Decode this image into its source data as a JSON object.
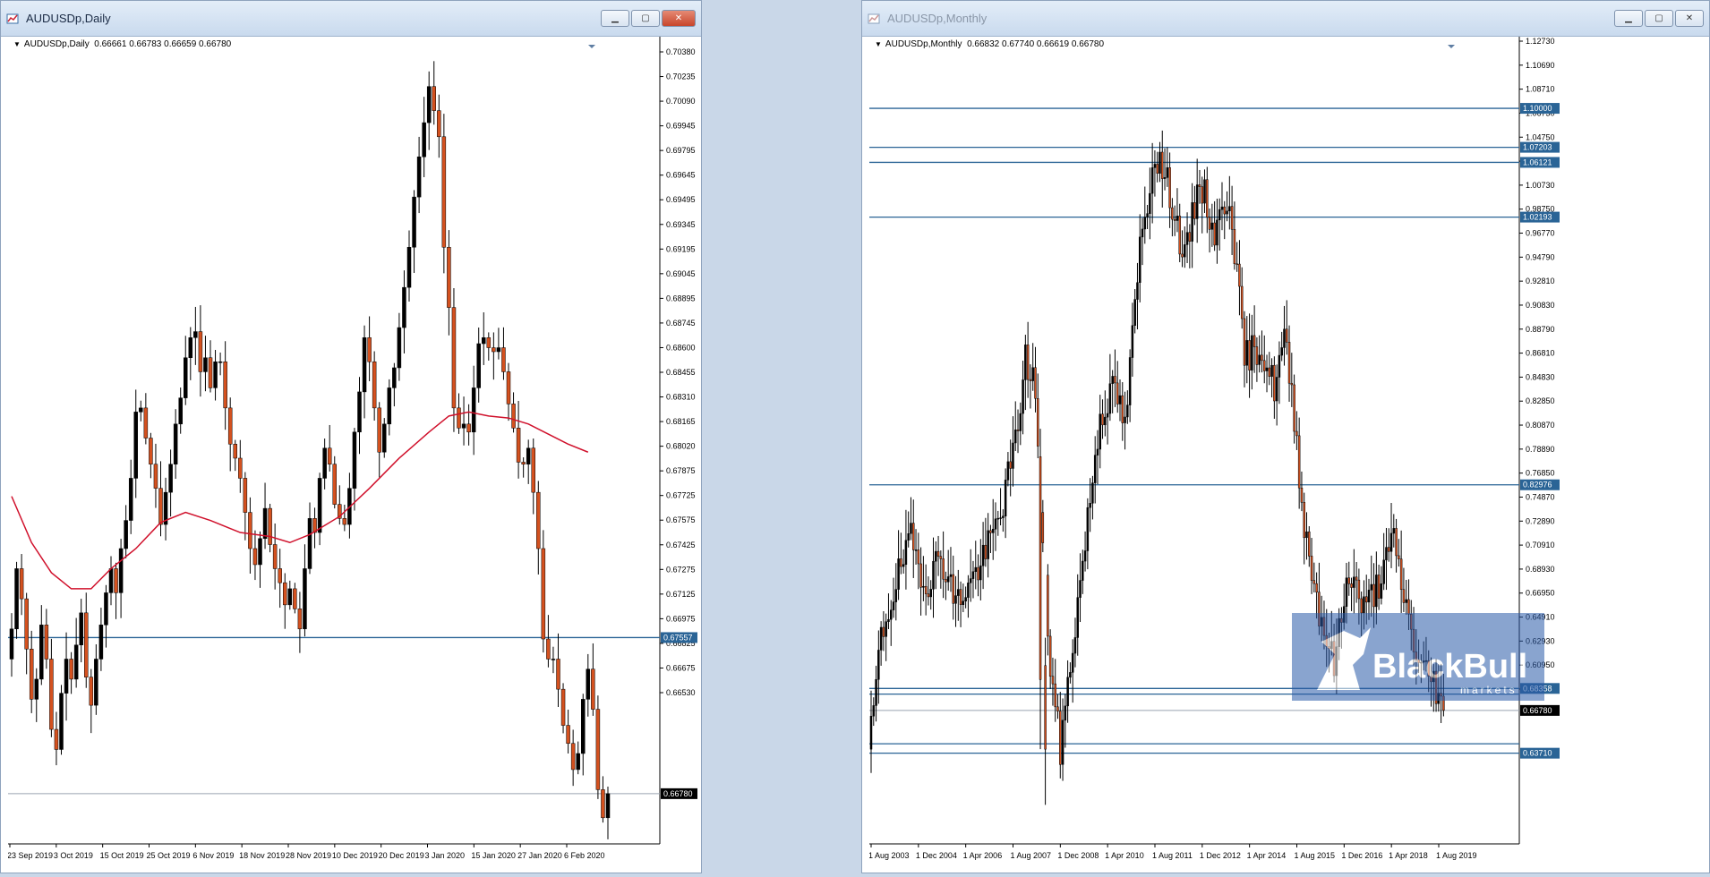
{
  "windows": {
    "left": {
      "title": "AUDUSDp,Daily",
      "info_symbol": "AUDUSDp,Daily",
      "info_ohlc": "0.66661 0.66783 0.66659 0.66780",
      "price_scale": [
        "0.70380",
        "0.70235",
        "0.70090",
        "0.69945",
        "0.69795",
        "0.69645",
        "0.69495",
        "0.69345",
        "0.69195",
        "0.69045",
        "0.68895",
        "0.68745",
        "0.68600",
        "0.68455",
        "0.68310",
        "0.68165",
        "0.68020",
        "0.67875",
        "0.67725",
        "0.67575",
        "0.67425",
        "0.67275",
        "0.67125",
        "0.66975",
        "0.66825",
        "0.66675",
        "0.66530"
      ],
      "date_scale": [
        "23 Sep 2019",
        "3 Oct 2019",
        "15 Oct 2019",
        "25 Oct 2019",
        "6 Nov 2019",
        "18 Nov 2019",
        "28 Nov 2019",
        "10 Dec 2019",
        "20 Dec 2019",
        "3 Jan 2020",
        "15 Jan 2020",
        "27 Jan 2020",
        "6 Feb 2020"
      ],
      "line_tags": [
        "0.67557"
      ],
      "current_tag": "0.66780",
      "line_levels": [
        0.67557
      ],
      "current_price": 0.6678
    },
    "right": {
      "title": "AUDUSDp,Monthly",
      "info_symbol": "AUDUSDp,Monthly",
      "info_ohlc": "0.66832 0.67740 0.66619 0.66780",
      "price_scale": [
        "1.12730",
        "1.10690",
        "1.08710",
        "1.06730",
        "1.04750",
        "1.02770",
        "1.00730",
        "0.98750",
        "0.96770",
        "0.94790",
        "0.92810",
        "0.90830",
        "0.88790",
        "0.86810",
        "0.84830",
        "0.82850",
        "0.80870",
        "0.78890",
        "0.76850",
        "0.74870",
        "0.72890",
        "0.70910",
        "0.68930",
        "0.66950",
        "0.64910",
        "0.62930",
        "0.60950",
        "0.58970"
      ],
      "date_scale": [
        "1 Aug 2003",
        "1 Dec 2004",
        "1 Apr 2006",
        "1 Aug 2007",
        "1 Dec 2008",
        "1 Apr 2010",
        "1 Aug 2011",
        "1 Dec 2012",
        "1 Apr 2014",
        "1 Aug 2015",
        "1 Dec 2016",
        "1 Apr 2018",
        "1 Aug 2019"
      ],
      "line_tags": [
        "1.10000",
        "1.07203",
        "1.06121",
        "1.02193",
        "0.82976",
        "0.68358",
        "0.63710"
      ],
      "current_tag": "0.66780",
      "line_levels": [
        1.1,
        1.07203,
        1.06121,
        1.02193,
        0.82976,
        0.68358,
        0.6795,
        0.64387,
        0.6371
      ],
      "current_price": 0.6678
    }
  },
  "colors": {
    "bull": "#000000",
    "bear": "#d4511f",
    "ma": "#d0102b",
    "hline": "#2a6496",
    "tag_bg": "#2a6496",
    "current_bg": "#000000",
    "close_btn": "#c8462c"
  },
  "watermark": {
    "brand": "BlackBull",
    "sub": "markets"
  },
  "chart_data": [
    {
      "type": "candlestick",
      "title": "AUDUSDp,Daily",
      "ylim": [
        0.6653,
        0.7045
      ],
      "x_ticks": [
        "23 Sep 2019",
        "3 Oct 2019",
        "15 Oct 2019",
        "25 Oct 2019",
        "6 Nov 2019",
        "18 Nov 2019",
        "28 Nov 2019",
        "10 Dec 2019",
        "20 Dec 2019",
        "3 Jan 2020",
        "15 Jan 2020",
        "27 Jan 2020",
        "6 Feb 2020"
      ],
      "ma_period_shown": true,
      "closes": [
        0.676,
        0.679,
        0.6775,
        0.675,
        0.6725,
        0.6735,
        0.6762,
        0.6745,
        0.671,
        0.67,
        0.6728,
        0.6745,
        0.6735,
        0.6752,
        0.6768,
        0.6736,
        0.6722,
        0.6745,
        0.6762,
        0.6778,
        0.679,
        0.6778,
        0.68,
        0.6814,
        0.6835,
        0.6868,
        0.687,
        0.6855,
        0.6842,
        0.683,
        0.6812,
        0.6828,
        0.6842,
        0.6862,
        0.6875,
        0.6895,
        0.6905,
        0.6908,
        0.6888,
        0.6895,
        0.688,
        0.6893,
        0.6893,
        0.687,
        0.6852,
        0.6845,
        0.6835,
        0.6818,
        0.68,
        0.6792,
        0.6805,
        0.682,
        0.6802,
        0.679,
        0.6783,
        0.6772,
        0.678,
        0.677,
        0.676,
        0.679,
        0.6815,
        0.6808,
        0.6835,
        0.685,
        0.6842,
        0.6822,
        0.6815,
        0.6812,
        0.683,
        0.6858,
        0.6878,
        0.6905,
        0.6893,
        0.687,
        0.6848,
        0.6862,
        0.688,
        0.689,
        0.691,
        0.693,
        0.695,
        0.6975,
        0.6995,
        0.7012,
        0.703,
        0.7018,
        0.7005,
        0.695,
        0.692,
        0.687,
        0.686,
        0.6862,
        0.6858,
        0.688,
        0.6902,
        0.6905,
        0.69,
        0.6898,
        0.69,
        0.6888,
        0.6872,
        0.686,
        0.6843,
        0.6842,
        0.685,
        0.6828,
        0.68,
        0.6755,
        0.6745,
        0.6745,
        0.673,
        0.6712,
        0.6703,
        0.669,
        0.6698,
        0.6725,
        0.674,
        0.672,
        0.668,
        0.6666,
        0.6678
      ],
      "ma_range_approx": [
        0.6768,
        0.6868
      ],
      "hlines": [
        0.67557
      ],
      "current": 0.6678
    },
    {
      "type": "candlestick",
      "title": "AUDUSDp,Monthly",
      "ylim": [
        0.572,
        1.1373
      ],
      "x_ticks": [
        "1 Aug 2003",
        "1 Dec 2004",
        "1 Apr 2006",
        "1 Aug 2007",
        "1 Dec 2008",
        "1 Apr 2010",
        "1 Aug 2011",
        "1 Dec 2012",
        "1 Apr 2014",
        "1 Aug 2015",
        "1 Dec 2016",
        "1 Apr 2018",
        "1 Aug 2019"
      ],
      "anchors": [
        [
          0,
          0.652
        ],
        [
          4,
          0.72
        ],
        [
          10,
          0.76
        ],
        [
          16,
          0.79
        ],
        [
          22,
          0.758
        ],
        [
          28,
          0.78
        ],
        [
          34,
          0.745
        ],
        [
          40,
          0.76
        ],
        [
          46,
          0.78
        ],
        [
          52,
          0.81
        ],
        [
          58,
          0.86
        ],
        [
          62,
          0.92
        ],
        [
          66,
          0.9
        ],
        [
          68,
          0.81
        ],
        [
          72,
          0.7
        ],
        [
          76,
          0.64
        ],
        [
          80,
          0.7
        ],
        [
          86,
          0.79
        ],
        [
          92,
          0.88
        ],
        [
          98,
          0.9
        ],
        [
          102,
          0.87
        ],
        [
          108,
          1.0
        ],
        [
          114,
          1.07
        ],
        [
          120,
          1.04
        ],
        [
          126,
          0.99
        ],
        [
          132,
          1.05
        ],
        [
          138,
          1.01
        ],
        [
          144,
          1.04
        ],
        [
          150,
          0.92
        ],
        [
          156,
          0.93
        ],
        [
          162,
          0.9
        ],
        [
          166,
          0.935
        ],
        [
          170,
          0.88
        ],
        [
          174,
          0.8
        ],
        [
          180,
          0.74
        ],
        [
          186,
          0.7
        ],
        [
          192,
          0.77
        ],
        [
          198,
          0.74
        ],
        [
          204,
          0.76
        ],
        [
          210,
          0.79
        ],
        [
          214,
          0.75
        ],
        [
          220,
          0.7
        ],
        [
          226,
          0.69
        ],
        [
          230,
          0.6678
        ]
      ],
      "hlines": [
        1.1,
        1.07203,
        1.06121,
        1.02193,
        0.82976,
        0.68358,
        0.6795,
        0.64387,
        0.6371
      ],
      "current": 0.6678
    }
  ]
}
